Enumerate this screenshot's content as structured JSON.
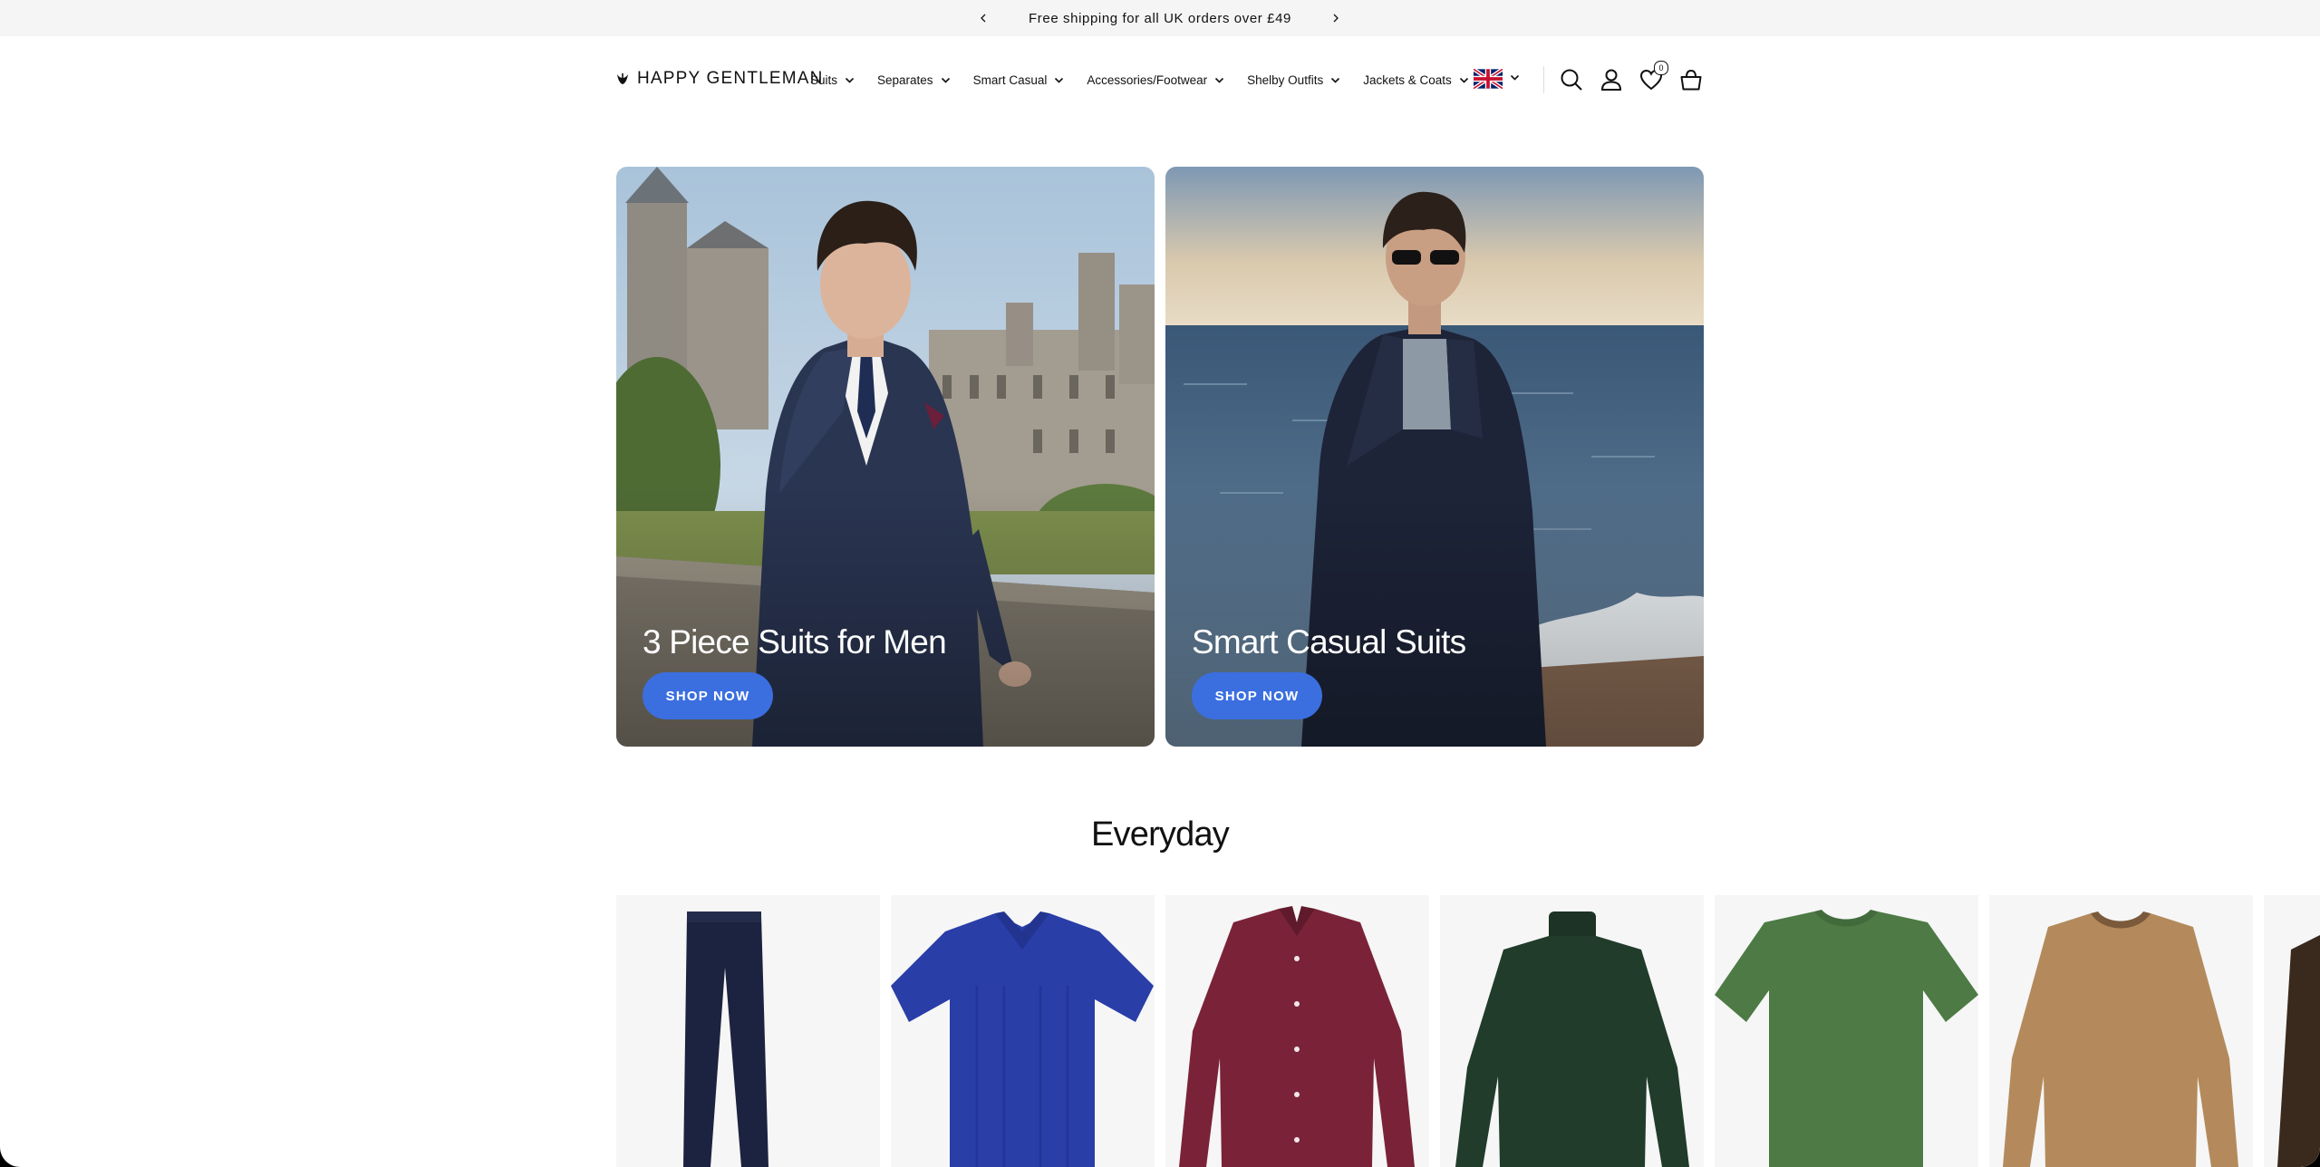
{
  "announcement": {
    "message": "Free shipping for all UK orders over £49"
  },
  "header": {
    "logo_text": "HAPPY GENTLEMAN",
    "nav": [
      {
        "label": "Suits"
      },
      {
        "label": "Separates"
      },
      {
        "label": "Smart Casual"
      },
      {
        "label": "Accessories/Footwear"
      },
      {
        "label": "Shelby Outfits"
      },
      {
        "label": "Jackets & Coats"
      }
    ],
    "wishlist_count": "0"
  },
  "banners": [
    {
      "title": "3 Piece Suits for Men",
      "button": "SHOP NOW"
    },
    {
      "title": "Smart Casual Suits",
      "button": "SHOP NOW"
    }
  ],
  "section": {
    "title": "Everyday"
  },
  "colors": {
    "accent": "#3b6fe0",
    "announcement_bg": "#f5f5f5",
    "card_bg": "#f6f6f6"
  }
}
